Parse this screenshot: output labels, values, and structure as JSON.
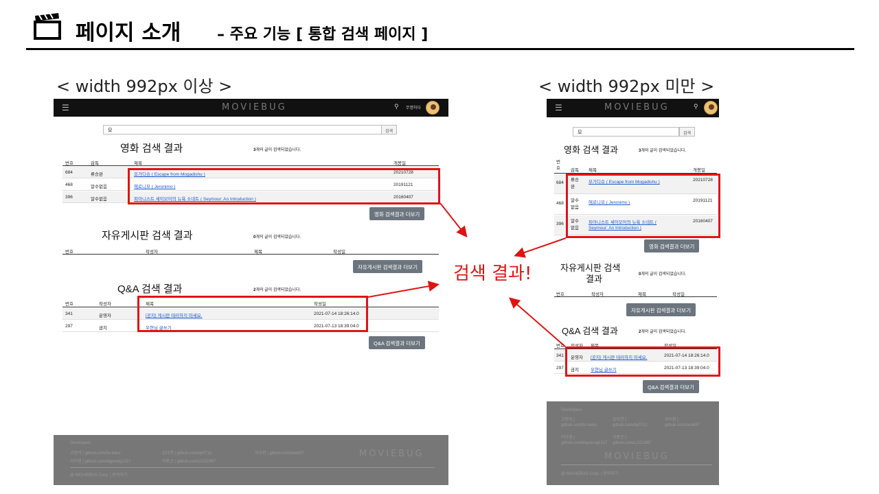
{
  "slide": {
    "title": "페이지 소개",
    "subtitle": "– 주요 기능 [ 통합 검색 페이지 ]",
    "caption_wide": "< width 992px 이상 >",
    "caption_narrow": "< width 992px 미만 >",
    "callout": "검색 결과!"
  },
  "app": {
    "logo": "MOVIEBUG",
    "menu_icon": "hamburger-icon",
    "search_icon": "search-icon",
    "login": "무명하다",
    "search_value": "모",
    "search_button": "검색"
  },
  "movie": {
    "title": "영화 검색 결과",
    "count_num": "3",
    "count_text": "개의 글이 검색되었습니다.",
    "headers": [
      "번호",
      "감독",
      "제목",
      "개봉일"
    ],
    "headers_narrow_no": "번호",
    "rows": [
      {
        "no": "684",
        "director": "류승완",
        "director_narrow": "류승완",
        "title": "모가디슈 ( Escape from Mogadishu )",
        "date": "20210728"
      },
      {
        "no": "468",
        "director": "알수없음",
        "director_narrow": "알수없음",
        "title": "헤로니모 ( Jeronimo )",
        "date": "20191121"
      },
      {
        "no": "396",
        "director": "알수없음",
        "director_narrow": "알수없음",
        "title": "피아니스트 세이모어의 뉴욕 소네트 ( Seymour: An Introduction )",
        "title_narrow_1": "피아니스트 세이모어의 뉴욕 소네트 (",
        "title_narrow_2": "Seymour: An Introduction )",
        "date": "20160407"
      }
    ],
    "more": "영화 검색결과 더보기"
  },
  "board": {
    "title": "자유게시판 검색 결과",
    "title_narrow_1": "자유게시판 검색",
    "title_narrow_2": "결과",
    "count_num": "0",
    "count_text": "개의 글이 검색되었습니다.",
    "headers": [
      "번호",
      "작성자",
      "제목",
      "작성일"
    ],
    "more": "자유게시판 검색결과 더보기"
  },
  "qna": {
    "title": "Q&A 검색 결과",
    "count_num": "2",
    "count_text": "개의 글이 검색되었습니다.",
    "headers": [
      "번호",
      "작성자",
      "제목",
      "작성일"
    ],
    "rows": [
      {
        "no": "341",
        "author": "운영자",
        "title": "[공지] 게시판 테러하지 마세요.",
        "date": "2021-07-14 18:26:14.0"
      },
      {
        "no": "297",
        "author": "금지",
        "title": "우현님 글쓰기",
        "date": "2021-07-13 18:39:04.0"
      }
    ],
    "more": "Q&A 검색결과 더보기"
  },
  "footer": {
    "developers": "Developers",
    "dev1": "고현석 | github.com/hs-keko",
    "dev2": "이다영 | github.com/dayoung1327",
    "dev3": "김다연 | github.com/dy0712",
    "dev4": "이중근 | github.com/LCG1997",
    "dev5": "석우현 | github.com/seok97",
    "copy": "@ MOVIEBUG Corp. | 문의하기",
    "narrow": {
      "d1a": "고현석 |",
      "d1b": "github.com/hs-keko",
      "d3a": "김다연 |",
      "d3b": "github.com/dy0712",
      "d5a": "석우현 |",
      "d5b": "github.com/seok97",
      "d2a": "이다영 |",
      "d2b": "github.com/dayoung1327",
      "d4a": "이중근 |",
      "d4b": "github.com/LCG1997"
    }
  },
  "colors": {
    "accent_red": "#e01313",
    "nav_bg": "#111111",
    "button_gray": "#6c757d"
  }
}
